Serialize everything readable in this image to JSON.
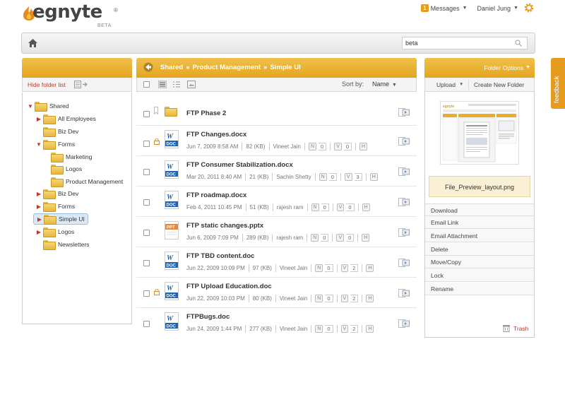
{
  "brand": {
    "name": "egnyte",
    "tag": "BETA",
    "reg": "®"
  },
  "header": {
    "messages_count": "1",
    "messages_label": "Messages",
    "user": "Daniel Jung"
  },
  "search": {
    "value": "beta"
  },
  "left": {
    "hide_label": "Hide folder list",
    "tree": [
      {
        "label": "Shared",
        "expanded": true
      },
      {
        "label": "All Employees",
        "expanded": false
      },
      {
        "label": "Biz Dev",
        "expanded": null
      },
      {
        "label": "Forms",
        "expanded": true
      },
      {
        "label": "Marketing",
        "expanded": null
      },
      {
        "label": "Logos",
        "expanded": null
      },
      {
        "label": "Product Management",
        "expanded": null
      },
      {
        "label": "Biz Dev",
        "expanded": false
      },
      {
        "label": "Forms",
        "expanded": false
      },
      {
        "label": "Simple UI",
        "expanded": false
      },
      {
        "label": "Logos",
        "expanded": false
      },
      {
        "label": "Newsletters",
        "expanded": null
      }
    ]
  },
  "breadcrumb": {
    "items": [
      "Shared",
      "Product Management",
      "Simple UI"
    ],
    "sep": "»"
  },
  "list": {
    "sort_label": "Sort by:",
    "sort_value": "Name",
    "files": [
      {
        "name": "FTP Phase 2",
        "type": "folder"
      },
      {
        "name": "FTP Changes.docx",
        "date": "Jun 7, 2009 8:58 AM",
        "size": "82 (KB)",
        "owner": "Vineet Jain",
        "n": "0",
        "v": "0",
        "icon": "DOC",
        "locked": true
      },
      {
        "name": "FTP Consumer Stabilization.docx",
        "date": "Mar 20, 2011 8:40 AM",
        "size": "21 (KB)",
        "owner": "Sachin Shetty",
        "n": "0",
        "v": "3",
        "icon": "DOC"
      },
      {
        "name": "FTP roadmap.docx",
        "date": "Feb 4, 2011 10:45 PM",
        "size": "51 (KB)",
        "owner": "rajesh ram",
        "n": "0",
        "v": "0",
        "icon": "DOC"
      },
      {
        "name": "FTP static changes.pptx",
        "date": "Jun 6, 2009 7:09 PM",
        "size": "289 (KB)",
        "owner": "rajesh ram",
        "n": "0",
        "v": "0",
        "icon": "PPT"
      },
      {
        "name": "FTP TBD content.doc",
        "date": "Jun 22, 2009 10:09 PM",
        "size": "97 (KB)",
        "owner": "Vineet Jain",
        "n": "0",
        "v": "2",
        "icon": "DOC"
      },
      {
        "name": "FTP Upload Education.doc",
        "date": "Jun 22, 2009 10:03 PM",
        "size": "80 (KB)",
        "owner": "Vineet Jain",
        "n": "0",
        "v": "2",
        "icon": "DOC",
        "locked": true
      },
      {
        "name": "FTPBugs.doc",
        "date": "Jun 24, 2009 1:44 PM",
        "size": "277 (KB)",
        "owner": "Vineet Jain",
        "n": "0",
        "v": "2",
        "icon": "DOC"
      }
    ]
  },
  "right": {
    "folder_options": "Folder Options",
    "upload": "Upload",
    "create_folder": "Create New Folder",
    "preview_name": "File_Preview_layout.png",
    "actions": [
      "Download",
      "Email Link",
      "Email Attachment",
      "Delete",
      "Move/Copy",
      "Lock",
      "Rename"
    ],
    "trash": "Trash"
  },
  "feedback": "feedback",
  "colors": {
    "accent": "#e59b1d",
    "header_gold": "#e8ad2c",
    "doc_blue": "#1f64b4",
    "link_red": "#c0392b"
  }
}
